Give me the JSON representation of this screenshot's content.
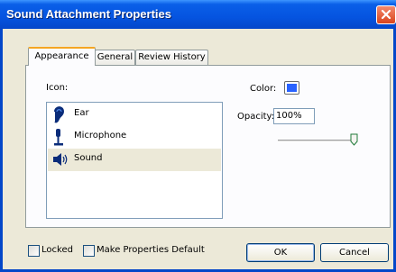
{
  "window": {
    "title": "Sound Attachment Properties",
    "accent_color": "#0554e0",
    "close_color": "#d9441d"
  },
  "tabs": [
    {
      "label": "Appearance",
      "active": true
    },
    {
      "label": "General",
      "active": false
    },
    {
      "label": "Review History",
      "active": false
    }
  ],
  "appearance": {
    "icon_label": "Icon:",
    "icons": [
      {
        "label": "Ear",
        "icon": "ear-icon",
        "selected": false
      },
      {
        "label": "Microphone",
        "icon": "microphone-icon",
        "selected": false
      },
      {
        "label": "Sound",
        "icon": "speaker-icon",
        "selected": true
      }
    ],
    "color_label": "Color:",
    "color_value": "#2962ff",
    "opacity_label": "Opacity:",
    "opacity_value": "100%",
    "opacity_level": 1.0
  },
  "footer": {
    "locked_label": "Locked",
    "locked_checked": false,
    "default_label": "Make Properties Default",
    "default_checked": false,
    "ok_label": "OK",
    "cancel_label": "Cancel"
  }
}
